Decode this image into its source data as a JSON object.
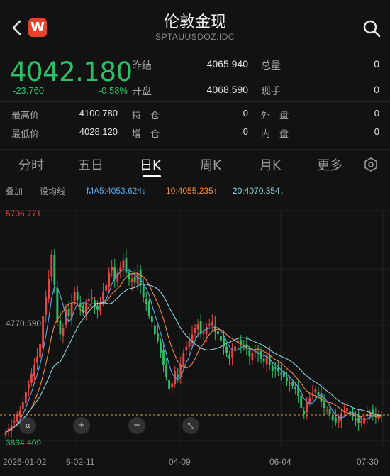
{
  "header": {
    "title": "伦敦金现",
    "subtitle": "SPTAUUSDOZ.IDC",
    "logo_text": "W"
  },
  "quote": {
    "price": "4042.180",
    "change": "-23.760",
    "change_pct": "-0.58%",
    "prev_close_label": "昨结",
    "prev_close": "4065.940",
    "open_label": "开盘",
    "open": "4068.590",
    "volume_label": "总量",
    "volume": "0",
    "cur_hand_label": "现手",
    "cur_hand": "0"
  },
  "stats": {
    "high_label": "最高价",
    "high": "4100.780",
    "low_label": "最低价",
    "low": "4028.120",
    "oi_label": "持　仓",
    "oi": "0",
    "oi_inc_label": "增　仓",
    "oi_inc": "0",
    "outer_label": "外　盘",
    "outer": "0",
    "inner_label": "内　盘",
    "inner": "0"
  },
  "tabs": [
    "分时",
    "五日",
    "日K",
    "周K",
    "月K",
    "更多"
  ],
  "active_tab": "日K",
  "indicators": {
    "overlay": "叠加",
    "settings": "设均线",
    "ma5": "MA5:4053.624↓",
    "ma10": "10:4055.235↑",
    "ma20": "20:4070.354↓"
  },
  "colors": {
    "up": "#e84545",
    "down": "#2dc068",
    "ma5": "#5aa8e8",
    "ma10": "#f08a3c",
    "ma20": "#8ed6e0",
    "background": "#121212"
  },
  "chart_data": {
    "type": "candlestick",
    "y_labels": [
      "5706.771",
      "4770.590",
      "3834.409"
    ],
    "ylim": [
      3834.409,
      5706.771
    ],
    "x_labels": [
      "2026-01-02",
      "6-02-11",
      "04-09",
      "06-04",
      "07-30"
    ],
    "close_series": [
      3900,
      3930,
      3960,
      3990,
      4050,
      4080,
      4150,
      4230,
      4300,
      4380,
      4450,
      4520,
      4620,
      4850,
      5000,
      5150,
      5350,
      5100,
      4800,
      4700,
      4750,
      4900,
      4850,
      4950,
      5050,
      4980,
      4920,
      4880,
      4950,
      4990,
      5000,
      4920,
      4900,
      4950,
      5050,
      5100,
      5200,
      5250,
      5150,
      5200,
      5250,
      5300,
      5200,
      5150,
      5150,
      5120,
      5200,
      5100,
      5000,
      4950,
      4850,
      4800,
      4700,
      4650,
      4550,
      4450,
      4350,
      4250,
      4300,
      4400,
      4350,
      4450,
      4550,
      4600,
      4650,
      4700,
      4750,
      4780,
      4700,
      4720,
      4760,
      4780,
      4800,
      4720,
      4700,
      4650,
      4600,
      4550,
      4500,
      4580,
      4600,
      4650,
      4620,
      4600,
      4580,
      4520,
      4550,
      4560,
      4540,
      4500,
      4480,
      4520,
      4450,
      4400,
      4420,
      4400,
      4380,
      4350,
      4320,
      4300,
      4280,
      4250,
      4200,
      4100,
      4050,
      4150,
      4180,
      4220,
      4250,
      4200,
      4150,
      4100,
      4080,
      4050,
      4000,
      3980,
      4020,
      4050,
      4080,
      4100,
      4050,
      4030,
      4000,
      3980,
      4000,
      4020,
      4050,
      4060,
      4050,
      4040,
      4020,
      4042
    ],
    "last_price_line": 4042.18,
    "grid": true
  }
}
